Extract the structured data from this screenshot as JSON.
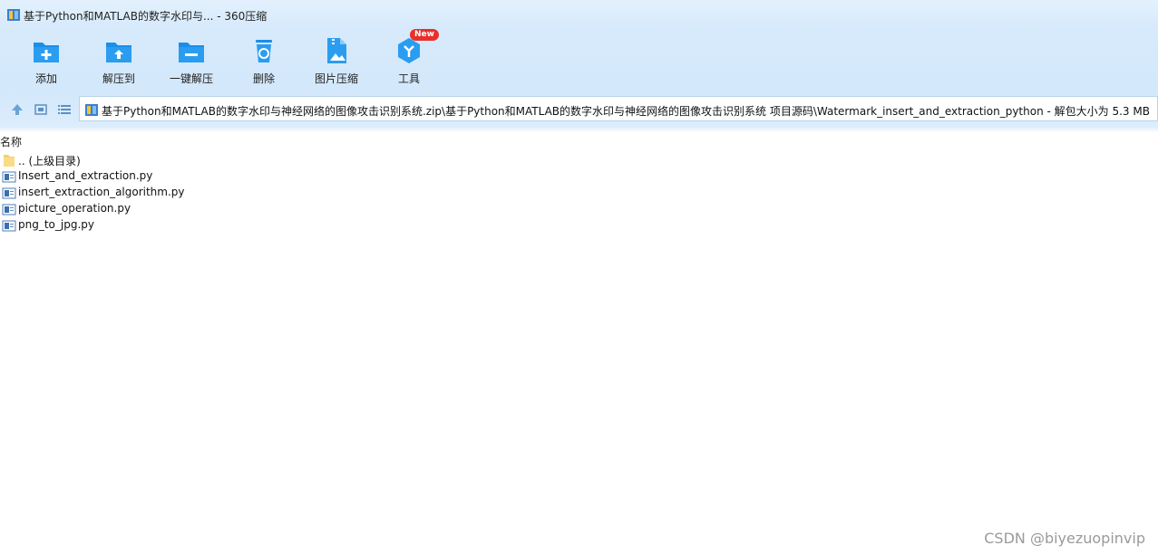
{
  "window": {
    "title": "基于Python和MATLAB的数字水印与... - 360压缩"
  },
  "toolbar": {
    "items": [
      {
        "label": "添加",
        "icon": "add-icon"
      },
      {
        "label": "解压到",
        "icon": "extract-to-icon"
      },
      {
        "label": "一键解压",
        "icon": "one-click-extract-icon"
      },
      {
        "label": "删除",
        "icon": "delete-icon"
      },
      {
        "label": "图片压缩",
        "icon": "image-compress-icon"
      },
      {
        "label": "工具",
        "icon": "tools-icon"
      }
    ],
    "new_badge": "New"
  },
  "nav": {
    "path": "基于Python和MATLAB的数字水印与神经网络的图像攻击识别系统.zip\\基于Python和MATLAB的数字水印与神经网络的图像攻击识别系统 项目源码\\Watermark_insert_and_extraction_python - 解包大小为 5.3 MB"
  },
  "columns": {
    "name": "名称"
  },
  "files": [
    {
      "name": ".. (上级目录)",
      "type": "parent"
    },
    {
      "name": "Insert_and_extraction.py",
      "type": "file"
    },
    {
      "name": "insert_extraction_algorithm.py",
      "type": "file"
    },
    {
      "name": "picture_operation.py",
      "type": "file"
    },
    {
      "name": "png_to_jpg.py",
      "type": "file"
    }
  ],
  "watermark": "CSDN @biyezuopinvip",
  "colors": {
    "toolbar_bg": "#d7eafb",
    "icon_blue": "#1a8fe8",
    "badge_red": "#e8302b"
  }
}
